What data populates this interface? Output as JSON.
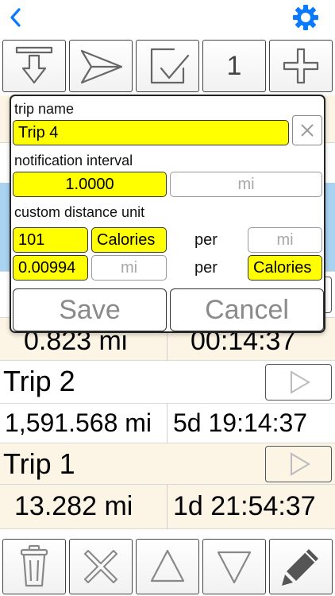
{
  "nav": {
    "back_icon": "chevron-left-icon",
    "settings_icon": "gear-icon",
    "accent": "#0a7aff"
  },
  "toolbar_top": {
    "items": [
      {
        "icon": "import-down-icon"
      },
      {
        "icon": "send-icon"
      },
      {
        "icon": "checkbox-icon"
      },
      {
        "count": "1"
      },
      {
        "icon": "plus-icon"
      }
    ]
  },
  "trips": [
    {
      "name": "Trip 2",
      "distance": "1,591.568 mi",
      "duration": "5d 19:14:37"
    },
    {
      "name": "Trip 1",
      "distance": "13.282 mi",
      "duration": "1d 21:54:37"
    }
  ],
  "partial_row": {
    "distance": "0.823 mi",
    "duration": "00:14:37"
  },
  "dialog": {
    "trip_name_label": "trip name",
    "trip_name_value": "Trip 4",
    "interval_label": "notification interval",
    "interval_value": "1.0000",
    "interval_unit_placeholder": "mi",
    "custom_unit_label": "custom distance unit",
    "row1": {
      "amount": "101",
      "unit": "Calories",
      "per": "per",
      "per_unit": "mi"
    },
    "row2": {
      "amount": "0.00994",
      "unit": "mi",
      "per": "per",
      "per_unit": "Calories"
    },
    "save_label": "Save",
    "cancel_label": "Cancel",
    "highlight_color": "#ffff00"
  },
  "toolbar_bottom": {
    "items": [
      {
        "icon": "trash-icon"
      },
      {
        "icon": "x-icon"
      },
      {
        "icon": "triangle-up-icon"
      },
      {
        "icon": "triangle-down-icon"
      },
      {
        "icon": "pencil-icon"
      }
    ]
  }
}
